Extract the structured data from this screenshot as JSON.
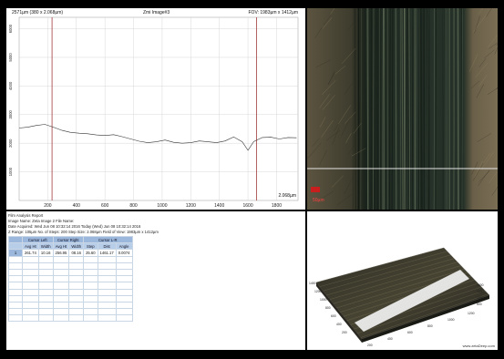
{
  "chart": {
    "header_left": "2571µm (380 x 2.068µm)",
    "header_center": "Zmi Image#3",
    "header_right": "FOV: 1983µm x 1412µm",
    "corner_label": "2.068µm",
    "x_ticks": [
      "200",
      "400",
      "600",
      "800",
      "1000",
      "1200",
      "1400",
      "1600",
      "1800"
    ],
    "y_ticks": [
      "6000",
      "5000",
      "4000",
      "3000",
      "2000",
      "1000"
    ],
    "colors": {
      "profile": "#333333",
      "cursor": "#a03a3a",
      "grid": "#cfcfcf"
    }
  },
  "chart_data": {
    "type": "line",
    "xlim": [
      0,
      1950
    ],
    "ylim": [
      0,
      6400
    ],
    "grid": true,
    "x": [
      0,
      60,
      120,
      180,
      240,
      300,
      360,
      420,
      480,
      540,
      600,
      660,
      720,
      780,
      840,
      900,
      960,
      1020,
      1080,
      1140,
      1200,
      1260,
      1320,
      1380,
      1440,
      1500,
      1560,
      1600,
      1640,
      1700,
      1760,
      1820,
      1880,
      1940
    ],
    "y": [
      2530,
      2560,
      2620,
      2660,
      2560,
      2450,
      2380,
      2350,
      2330,
      2290,
      2270,
      2300,
      2230,
      2150,
      2070,
      2020,
      2050,
      2110,
      2030,
      2000,
      2020,
      2080,
      2050,
      2020,
      2080,
      2220,
      2050,
      1750,
      2060,
      2200,
      2210,
      2150,
      2200,
      2190
    ],
    "cursors_x": [
      230,
      1660
    ]
  },
  "micro": {
    "scale_label": "50µm",
    "colors": {
      "base": "#4f4838",
      "track": "#1e2a22",
      "line": "#e6e6e6"
    }
  },
  "surface": {
    "watermark": "www.zetaDeep.com",
    "axis_ticks_left": [
      "1400",
      "1200",
      "1000",
      "800",
      "600",
      "400",
      "200"
    ],
    "axis_ticks_bottom": [
      "200",
      "400",
      "600",
      "800",
      "1000",
      "1200"
    ],
    "axis_ticks_right": [
      "1400",
      "1200",
      "1000",
      "800"
    ]
  },
  "report": {
    "title": "Film Analysis Report",
    "image_name": "Image Name:  Zeta Image 2  File Name:",
    "date": "Date Acquired:       Wed Jun 08 10:32:14 2016    Today (Wed) Jun 08 10:32:14 2016",
    "zrange": "Z Range:      105µm  No. of Steps:  200    Step Size:     2.068µm        Field of View:  1983µm x 1412µm",
    "groups": [
      "Cursor Left",
      "Cursor Right",
      "Cursor L-R"
    ],
    "columns": [
      "Avg Ht",
      "Width",
      "Avg Ht",
      "Width",
      "Step",
      "Dist",
      "Angle"
    ],
    "rows": [
      {
        "idx": "1",
        "cells": [
          "261.74",
          "10.16",
          "256.95",
          "08.16",
          "25.60",
          "1461.17",
          "0.0074"
        ]
      }
    ]
  }
}
